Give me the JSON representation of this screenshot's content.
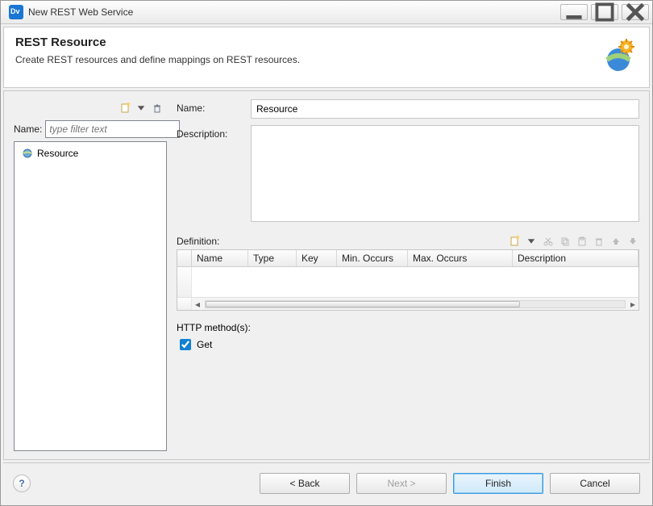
{
  "window": {
    "title": "New REST Web Service"
  },
  "banner": {
    "heading": "REST Resource",
    "subtitle": "Create REST resources and define mappings on REST resources."
  },
  "left": {
    "name_label": "Name:",
    "filter_placeholder": "type filter text",
    "tree_items": [
      {
        "label": "Resource"
      }
    ]
  },
  "right": {
    "name_label": "Name:",
    "name_value": "Resource",
    "description_label": "Description:",
    "description_value": "",
    "definition_label": "Definition:",
    "grid_columns": [
      "Name",
      "Type",
      "Key",
      "Min. Occurs",
      "Max. Occurs",
      "Description"
    ],
    "http_label": "HTTP method(s):",
    "http_methods": [
      {
        "label": "Get",
        "checked": true
      }
    ]
  },
  "footer": {
    "back": "< Back",
    "next": "Next >",
    "finish": "Finish",
    "cancel": "Cancel"
  }
}
